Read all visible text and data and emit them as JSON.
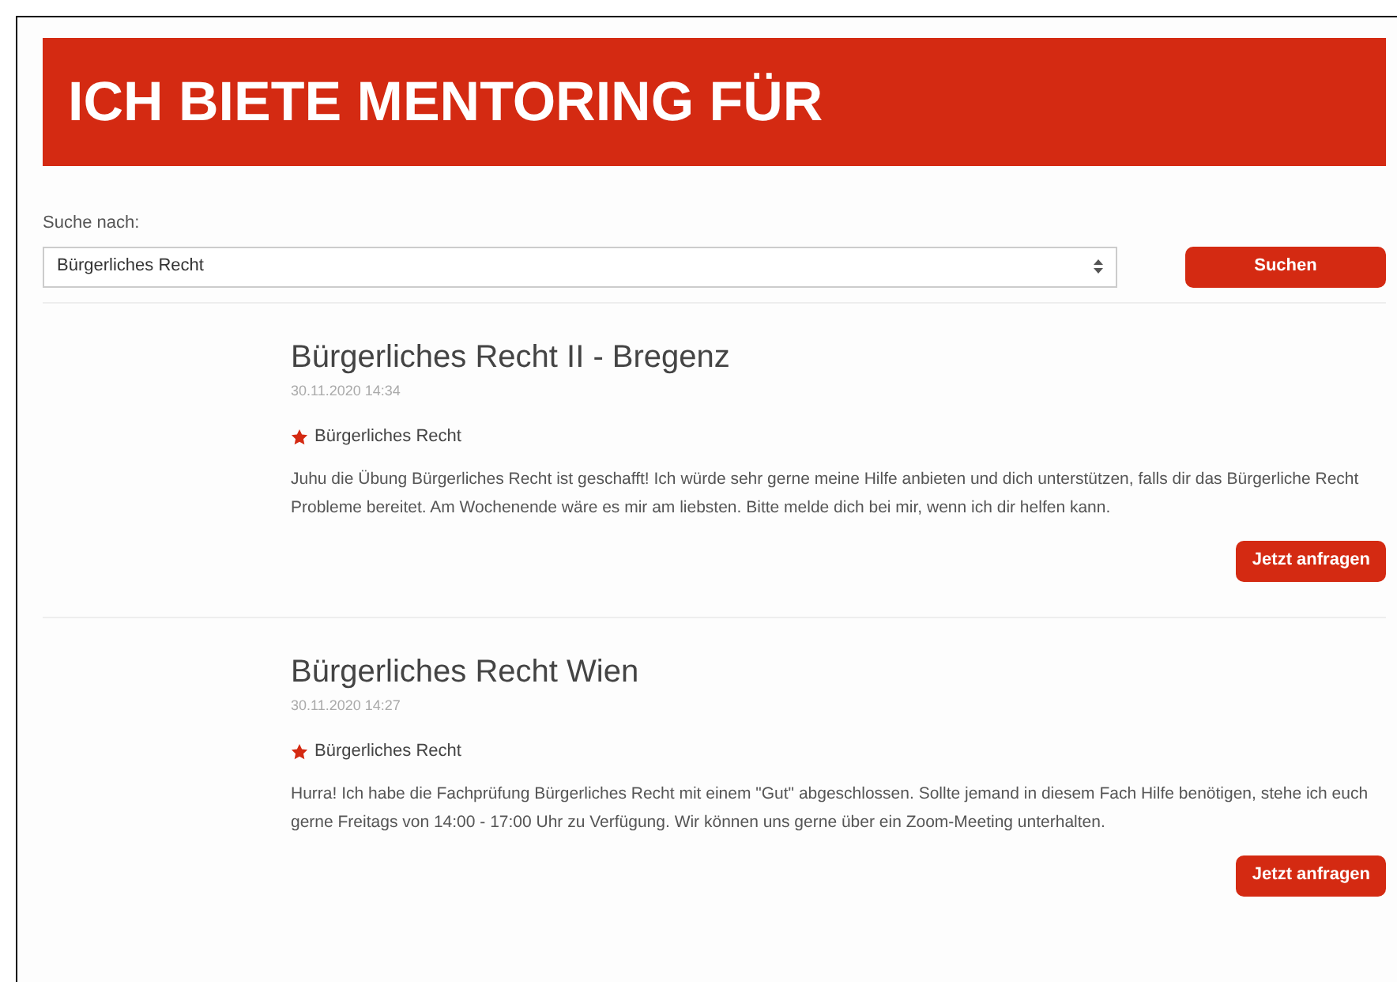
{
  "header": {
    "title": "ICH BIETE MENTORING FÜR"
  },
  "search": {
    "label": "Suche nach:",
    "value": "Bürgerliches Recht",
    "button": "Suchen"
  },
  "posts": [
    {
      "title": "Bürgerliches Recht II - Bregenz",
      "date": "30.11.2020 14:34",
      "tag": "Bürgerliches Recht",
      "text": "Juhu die Übung Bürgerliches Recht ist geschafft! Ich würde sehr gerne meine Hilfe anbieten und dich unterstützen, falls dir das Bürgerliche Recht Probleme bereitet. Am Wochenende wäre es mir am liebsten. Bitte melde dich bei mir, wenn ich dir helfen kann.",
      "button": "Jetzt anfragen"
    },
    {
      "title": "Bürgerliches Recht Wien",
      "date": "30.11.2020 14:27",
      "tag": "Bürgerliches Recht",
      "text": "Hurra! Ich habe die Fachprüfung Bürgerliches Recht mit einem \"Gut\" abgeschlossen. Sollte jemand in diesem Fach Hilfe benötigen, stehe ich euch gerne Freitags von 14:00 - 17:00 Uhr zu Verfügung. Wir können uns gerne über ein Zoom-Meeting unterhalten.",
      "button": "Jetzt anfragen"
    }
  ]
}
